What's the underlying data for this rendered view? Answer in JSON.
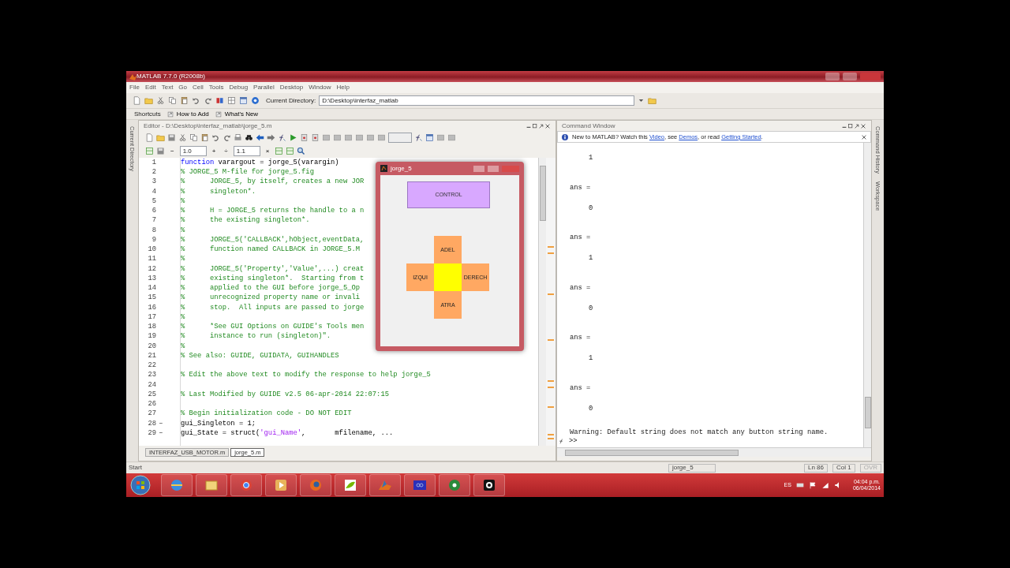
{
  "window": {
    "title": "MATLAB 7.7.0 (R2008b)"
  },
  "menu": [
    "File",
    "Edit",
    "Text",
    "Go",
    "Cell",
    "Tools",
    "Debug",
    "Parallel",
    "Desktop",
    "Window",
    "Help"
  ],
  "toolbar": {
    "directory_label": "Current Directory:",
    "directory": "D:\\Desktop\\interfaz_matlab"
  },
  "shortcuts": {
    "label": "Shortcuts",
    "items": [
      "How to Add",
      "What's New"
    ]
  },
  "side_tabs": {
    "left": [
      "Current Directory"
    ],
    "right": [
      "Command History",
      "Workspace"
    ]
  },
  "editor": {
    "title": "Editor - D:\\Desktop\\interfaz_matlab\\jorge_5.m",
    "cell_toolbar": {
      "minus": "−",
      "step_1": "1.0",
      "plus": "+",
      "divide": "÷",
      "step_2": "1.1",
      "times": "×"
    },
    "lines": [
      {
        "num": "1",
        "parts": [
          {
            "text": "function",
            "kind": "keyword"
          },
          {
            "text": " varargout = jorge_5(varargin)",
            "kind": "plain"
          }
        ]
      },
      {
        "num": "2",
        "parts": [
          {
            "text": "% JORGE_5 M-file for jorge_5.fig",
            "kind": "comment"
          }
        ]
      },
      {
        "num": "3",
        "parts": [
          {
            "text": "%      JORGE_5, by itself, creates a new JOR",
            "kind": "comment"
          }
        ]
      },
      {
        "num": "4",
        "parts": [
          {
            "text": "%      singleton*.",
            "kind": "comment"
          }
        ]
      },
      {
        "num": "5",
        "parts": [
          {
            "text": "%",
            "kind": "comment"
          }
        ]
      },
      {
        "num": "6",
        "parts": [
          {
            "text": "%      H = JORGE_5 returns the handle to a n",
            "kind": "comment"
          }
        ]
      },
      {
        "num": "7",
        "parts": [
          {
            "text": "%      the existing singleton*.",
            "kind": "comment"
          }
        ]
      },
      {
        "num": "8",
        "parts": [
          {
            "text": "%",
            "kind": "comment"
          }
        ]
      },
      {
        "num": "9",
        "parts": [
          {
            "text": "%      JORGE_5('CALLBACK',hObject,eventData,",
            "kind": "comment"
          }
        ]
      },
      {
        "num": "10",
        "parts": [
          {
            "text": "%      function named CALLBACK in JORGE_5.M",
            "kind": "comment"
          }
        ]
      },
      {
        "num": "11",
        "parts": [
          {
            "text": "%",
            "kind": "comment"
          }
        ]
      },
      {
        "num": "12",
        "parts": [
          {
            "text": "%      JORGE_5('Property','Value',...) creat",
            "kind": "comment"
          }
        ]
      },
      {
        "num": "13",
        "parts": [
          {
            "text": "%      existing singleton*.  Starting from t",
            "kind": "comment"
          }
        ]
      },
      {
        "num": "14",
        "parts": [
          {
            "text": "%      applied to the GUI before jorge_5_Op",
            "kind": "comment"
          }
        ]
      },
      {
        "num": "15",
        "parts": [
          {
            "text": "%      unrecognized property name or invali",
            "kind": "comment"
          }
        ]
      },
      {
        "num": "16",
        "parts": [
          {
            "text": "%      stop.  All inputs are passed to jorge",
            "kind": "comment"
          }
        ]
      },
      {
        "num": "17",
        "parts": [
          {
            "text": "%",
            "kind": "comment"
          }
        ]
      },
      {
        "num": "18",
        "parts": [
          {
            "text": "%      *See GUI Options on GUIDE's Tools men",
            "kind": "comment"
          }
        ]
      },
      {
        "num": "19",
        "parts": [
          {
            "text": "%      instance to run (singleton)\".",
            "kind": "comment"
          }
        ]
      },
      {
        "num": "20",
        "parts": [
          {
            "text": "%",
            "kind": "comment"
          }
        ]
      },
      {
        "num": "21",
        "parts": [
          {
            "text": "% See also: GUIDE, GUIDATA, GUIHANDLES",
            "kind": "comment"
          }
        ]
      },
      {
        "num": "22"
      },
      {
        "num": "23",
        "parts": [
          {
            "text": "% Edit the above text to modify the response to help jorge_5",
            "kind": "comment"
          }
        ]
      },
      {
        "num": "24"
      },
      {
        "num": "25",
        "parts": [
          {
            "text": "% Last Modified by GUIDE v2.5 06-apr-2014 22:07:15",
            "kind": "comment"
          }
        ]
      },
      {
        "num": "26"
      },
      {
        "num": "27",
        "parts": [
          {
            "text": "% Begin initialization code - DO NOT EDIT",
            "kind": "comment"
          }
        ]
      },
      {
        "num": "28",
        "dash": "–",
        "parts": [
          {
            "text": "gui_Singleton = 1;",
            "kind": "plain"
          }
        ]
      },
      {
        "num": "29",
        "dash": "–",
        "parts": [
          {
            "text": "gui_State = struct(",
            "kind": "plain"
          },
          {
            "text": "'gui_Name'",
            "kind": "string"
          },
          {
            "text": ",       mfilename, ...",
            "kind": "plain"
          }
        ]
      }
    ],
    "tabs": [
      {
        "label": "INTERFAZ_USB_MOTOR.m",
        "selected": false
      },
      {
        "label": "jorge_5.m",
        "selected": true
      }
    ]
  },
  "figure": {
    "title": "jorge_5",
    "control": "CONTROL",
    "pad": [
      {
        "kind": "up",
        "label": "ADEL",
        "color": "#ffa862"
      },
      {
        "kind": "left",
        "label": "IZQUI",
        "color": "#ffa862"
      },
      {
        "kind": "center",
        "color": "#ffff00"
      },
      {
        "kind": "right",
        "label": "DERECH",
        "color": "#ffa862"
      },
      {
        "kind": "down",
        "label": "ATRA",
        "color": "#ffa862"
      }
    ]
  },
  "command_window": {
    "title": "Command Window",
    "banner": [
      {
        "text": "New to MATLAB? Watch this ",
        "link": false
      },
      {
        "text": "Video",
        "link": true
      },
      {
        "text": ", see ",
        "link": false
      },
      {
        "text": "Demos",
        "link": true
      },
      {
        "text": ", or read ",
        "link": false
      },
      {
        "text": "Getting Started",
        "link": true
      },
      {
        "text": ".",
        "link": false
      }
    ],
    "output": [
      {
        "value": "1"
      },
      {
        "label": "ans =",
        "value": "0"
      },
      {
        "label": "ans =",
        "value": "1"
      },
      {
        "label": "ans =",
        "value": "0"
      },
      {
        "label": "ans =",
        "value": "1"
      },
      {
        "label": "ans =",
        "value": "0"
      }
    ],
    "warning": "Warning: Default string does not match any button string name.",
    "prompt": ">>"
  },
  "status_bar": {
    "start": "Start",
    "file": "jorge_5",
    "line": "Ln  86",
    "col": "Col  1",
    "mode": "OVR"
  },
  "taskbar": {
    "language": "ES",
    "time": "04:04 p.m.",
    "date": "06/04/2014"
  }
}
